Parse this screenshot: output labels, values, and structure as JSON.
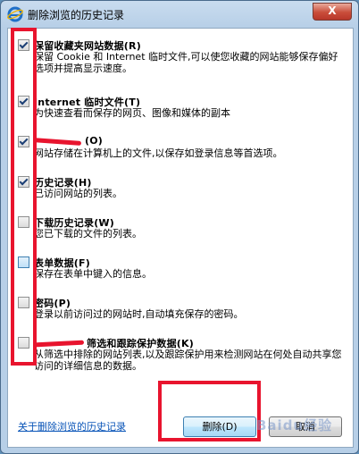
{
  "window": {
    "title": "删除浏览的历史记录",
    "close_label": "X"
  },
  "items": [
    {
      "title": "保留收藏夹网站数据(R)",
      "desc": "保留 Cookie 和 Internet 临时文件,可以使您收藏的网站能够保存偏好选项并提高显示速度。",
      "checked": true
    },
    {
      "title": "Internet 临时文件(T)",
      "desc": "为快速查看而保存的网页、图像和媒体的副本",
      "checked": true
    },
    {
      "title": "(O)",
      "desc": "网站存储在计算机上的文件,以保存如登录信息等首选项。",
      "checked": true
    },
    {
      "title": "历史记录(H)",
      "desc": "已访问网站的列表。",
      "checked": true
    },
    {
      "title": "下载历史记录(W)",
      "desc": "您已下载的文件的列表。",
      "checked": false
    },
    {
      "title": "表单数据(F)",
      "desc": "保存在表单中键入的信息。",
      "checked": false
    },
    {
      "title": "密码(P)",
      "desc": "登录以前访问过的网站时,自动填充保存的密码。",
      "checked": false
    },
    {
      "title": "筛选和跟踪保护数据(K)",
      "desc": "从筛选中排除的网站列表,以及跟踪保护用来检测网站在何处自动共享您访问的详细信息的数据。",
      "checked": false
    }
  ],
  "footer": {
    "link": "关于删除浏览的历史记录",
    "delete_label": "删除(D)",
    "cancel_label": "取消"
  },
  "watermark": "Baidu经验",
  "colors": {
    "annotation_red": "#e8142e",
    "link": "#0a55b8"
  }
}
